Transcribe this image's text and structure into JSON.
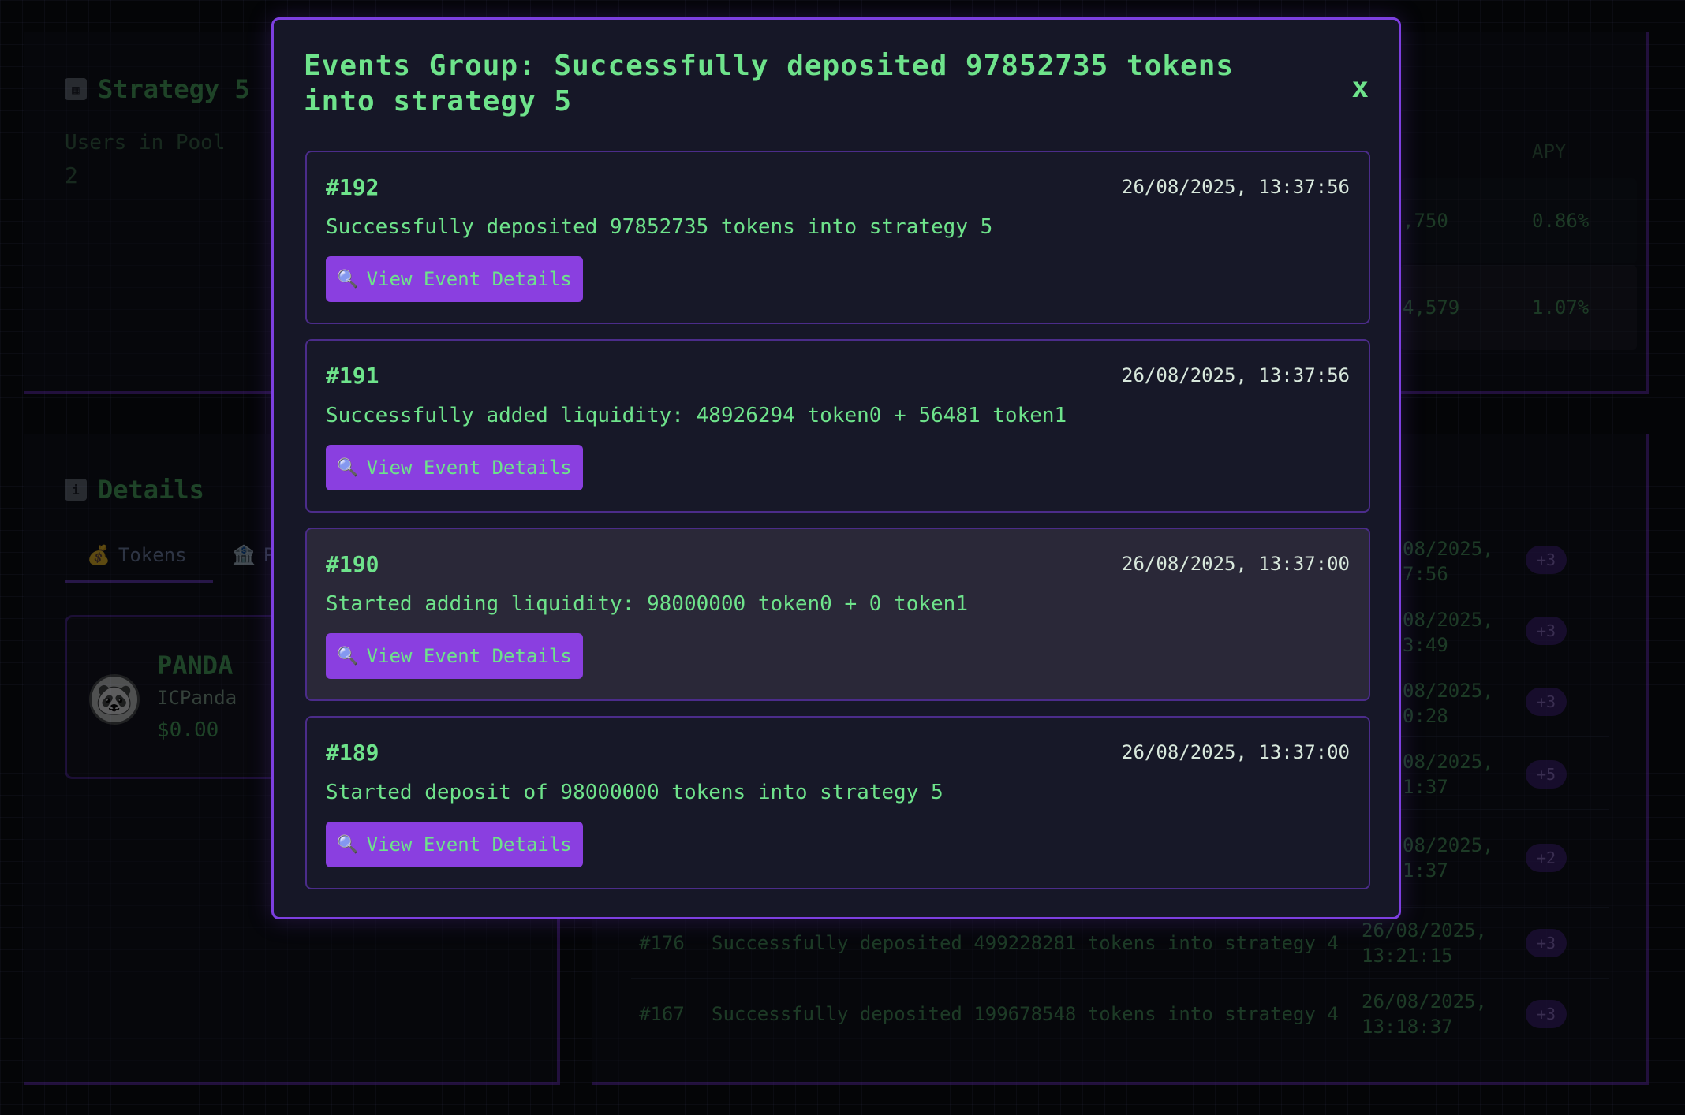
{
  "background": {
    "strategy_panel": {
      "title": "Strategy 5",
      "users_label": "Users in Pool",
      "users_value": "2",
      "apy_header": "APY",
      "rows": [
        {
          "amount": ",750",
          "apy": "0.86%"
        },
        {
          "amount": "4,579",
          "apy": "1.07%"
        }
      ]
    },
    "details_panel": {
      "title": "Details",
      "tabs": [
        {
          "icon": "money-bag-icon",
          "glyph": "💰",
          "label": "Tokens"
        },
        {
          "icon": "bank-icon",
          "glyph": "🏦",
          "label": "P"
        }
      ],
      "token": {
        "symbol": "PANDA",
        "name": "ICPanda",
        "value": "$0.00"
      }
    },
    "events_panel": {
      "rows": [
        {
          "time_line1": "08/2025,",
          "time_line2": "7:56",
          "badge": "+3"
        },
        {
          "time_line1": "08/2025,",
          "time_line2": "3:49",
          "badge": "+3"
        },
        {
          "time_line1": "08/2025,",
          "time_line2": "0:28",
          "badge": "+3"
        },
        {
          "time_line1": "08/2025,",
          "time_line2": "1:37",
          "badge": "+5"
        },
        {
          "time_line1": "08/2025,",
          "time_line2": "1:37",
          "badge": "+2"
        },
        {
          "id": "#176",
          "message": "Successfully deposited 499228281 tokens into strategy 4",
          "time_line1": "26/08/2025,",
          "time_line2": "13:21:15",
          "badge": "+3"
        },
        {
          "id": "#167",
          "message": "Successfully deposited 199678548 tokens into strategy 4",
          "time_line1": "26/08/2025,",
          "time_line2": "13:18:37",
          "badge": "+3"
        }
      ]
    }
  },
  "modal": {
    "title": "Events Group: Successfully deposited 97852735 tokens into strategy 5",
    "close_label": "x",
    "button_label": "View Event Details",
    "events": [
      {
        "id": "#192",
        "time": "26/08/2025, 13:37:56",
        "message": "Successfully deposited 97852735 tokens into strategy 5"
      },
      {
        "id": "#191",
        "time": "26/08/2025, 13:37:56",
        "message": "Successfully added liquidity: 48926294 token0 + 56481 token1"
      },
      {
        "id": "#190",
        "time": "26/08/2025, 13:37:00",
        "message": "Started adding liquidity: 98000000 token0 + 0 token1"
      },
      {
        "id": "#189",
        "time": "26/08/2025, 13:37:00",
        "message": "Started deposit of 98000000 tokens into strategy 5"
      }
    ]
  },
  "colors": {
    "accent": "#8a3fe0",
    "text_green": "#6ee38b",
    "border_purple": "#7d3fe0",
    "panel_bg": "#0e0f17"
  }
}
